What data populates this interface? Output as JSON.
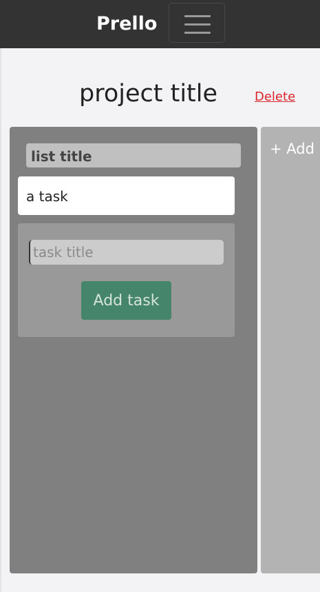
{
  "navbar": {
    "brand": "Prello",
    "menu_icon": "hamburger-menu-icon"
  },
  "project": {
    "title": "project title",
    "delete_label": "Delete"
  },
  "lists": [
    {
      "title": "list title",
      "tasks": [
        {
          "title": "a task"
        }
      ],
      "new_task": {
        "value": "",
        "placeholder": "task title",
        "button_label": "Add task"
      }
    }
  ],
  "add_list": {
    "label": "+ Add"
  },
  "colors": {
    "navbar_bg": "#333333",
    "list_bg": "#808080",
    "add_task_button": "#45856b",
    "delete_link": "#d9242b",
    "add_list_bg": "#b3b3b3"
  }
}
